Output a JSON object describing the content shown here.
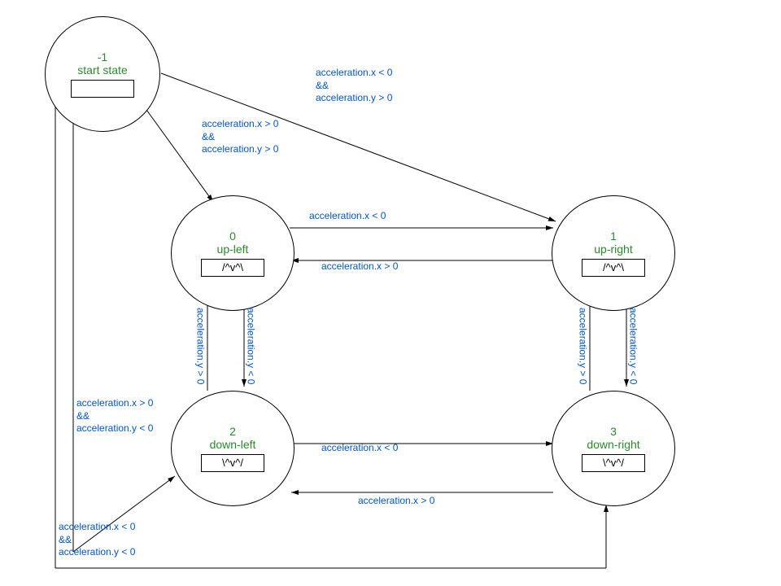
{
  "states": {
    "start": {
      "id": "-1",
      "name": "start state",
      "action": ""
    },
    "upLeft": {
      "id": "0",
      "name": "up-left",
      "action": "/^v^\\"
    },
    "upRight": {
      "id": "1",
      "name": "up-right",
      "action": "/^v^\\"
    },
    "downLeft": {
      "id": "2",
      "name": "down-left",
      "action": "\\^v^/"
    },
    "downRight": {
      "id": "3",
      "name": "down-right",
      "action": "\\^v^/"
    }
  },
  "edges": {
    "startToUpLeft": "acceleration.x > 0\n&&\nacceleration.y > 0",
    "startToUpRight": "acceleration.x < 0\n&&\nacceleration.y > 0",
    "startToDownLeft": "acceleration.x > 0\n&&\nacceleration.y < 0",
    "startToDownRight": "acceleration.x < 0\n&&\nacceleration.y < 0",
    "upLeftToUpRight": "acceleration.x < 0",
    "upRightToUpLeft": "acceleration.x > 0",
    "downLeftToDownRight": "acceleration.x < 0",
    "downRightToDownLeft": "acceleration.x > 0",
    "upLeftToDownLeft": "acceleration.y < 0",
    "downLeftToUpLeft": "acceleration.y > 0",
    "upRightToDownRight": "acceleration.y < 0",
    "downRightToUpRight": "acceleration.y > 0"
  }
}
